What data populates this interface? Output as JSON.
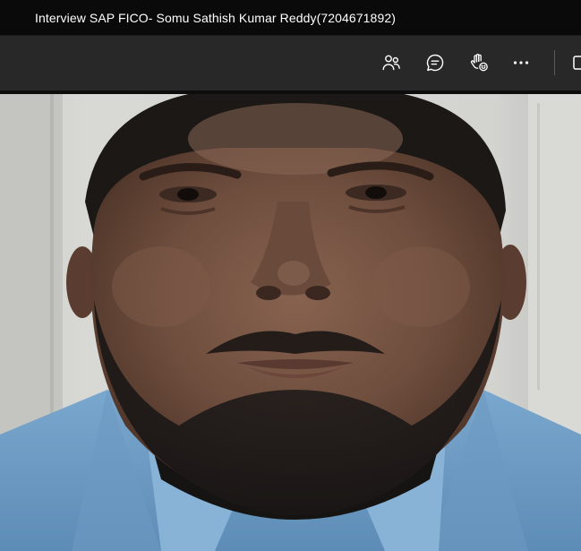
{
  "window": {
    "title": "Interview SAP FICO- Somu Sathish Kumar Reddy(7204671892)"
  },
  "toolbar": {
    "buttons": [
      {
        "icon": "people-icon"
      },
      {
        "icon": "chat-icon"
      },
      {
        "icon": "raise-hand-icon"
      },
      {
        "icon": "more-options-icon"
      }
    ]
  },
  "colors": {
    "titlebar": "#0a0a0a",
    "toolbar": "#282828",
    "icon": "#ffffff",
    "shirt": "#6f9ec6"
  }
}
